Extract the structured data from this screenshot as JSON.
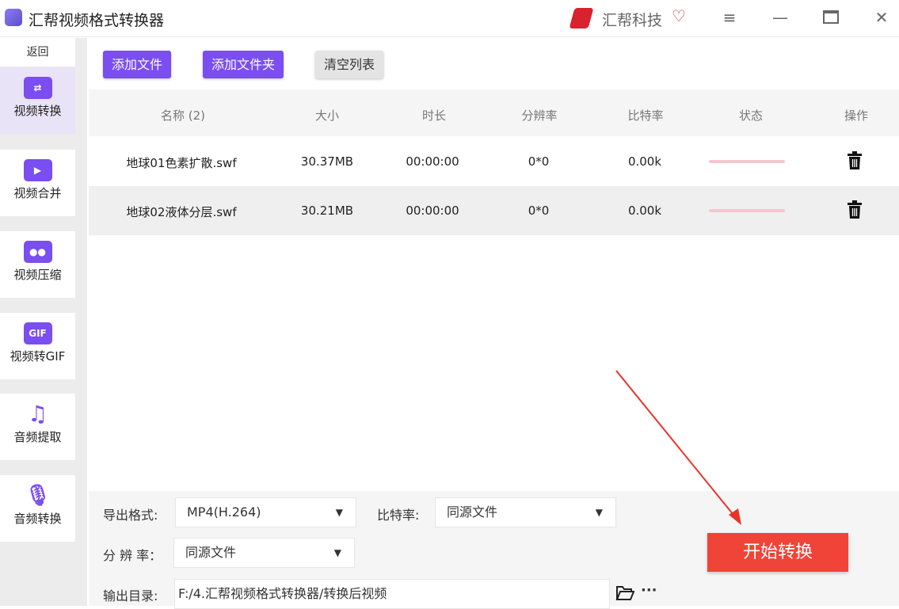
{
  "app": {
    "title": "汇帮视频格式转换器",
    "brand": "汇帮科技"
  },
  "window": {
    "menu": "≡",
    "minimize": "—",
    "close": "✕"
  },
  "sidebar": {
    "back": "返回",
    "items": [
      {
        "label": "视频转换",
        "icon": "video-convert-icon",
        "active": true
      },
      {
        "label": "视频合并",
        "icon": "video-merge-icon"
      },
      {
        "label": "视频压缩",
        "icon": "video-compress-icon"
      },
      {
        "label": "视频转GIF",
        "icon": "gif-icon"
      },
      {
        "label": "音频提取",
        "icon": "music-note-icon"
      },
      {
        "label": "音频转换",
        "icon": "microphone-icon"
      }
    ]
  },
  "toolbar": {
    "add_file": "添加文件",
    "add_folder": "添加文件夹",
    "clear": "清空列表"
  },
  "table": {
    "headers": [
      "名称 (2)",
      "大小",
      "时长",
      "分辨率",
      "比特率",
      "状态",
      "操作"
    ],
    "rows": [
      {
        "name": "地球01色素扩散.swf",
        "size": "30.37MB",
        "duration": "00:00:00",
        "resolution": "0*0",
        "bitrate": "0.00k",
        "progress": 0
      },
      {
        "name": "地球02液体分层.swf",
        "size": "30.21MB",
        "duration": "00:00:00",
        "resolution": "0*0",
        "bitrate": "0.00k",
        "progress": 0
      }
    ]
  },
  "settings": {
    "format_label": "导出格式:",
    "format_value": "MP4(H.264)",
    "bitrate_label": "比特率:",
    "bitrate_value": "同源文件",
    "resolution_label": "分 辨 率：",
    "resolution_value": "同源文件",
    "output_label": "输出目录:",
    "output_value": "F:/4.汇帮视频格式转换器/转换后视频",
    "more": "···"
  },
  "start_button": "开始转换",
  "colors": {
    "accent": "#7a4ef0",
    "start": "#f04438"
  }
}
